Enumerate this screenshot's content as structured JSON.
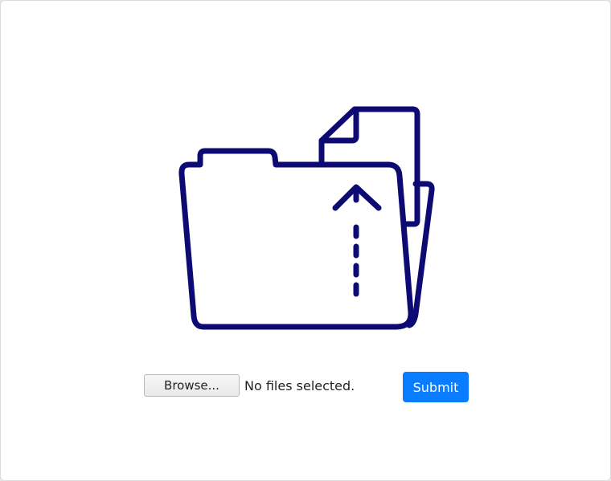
{
  "illustration": {
    "icon": "folder-upload-icon",
    "stroke_color": "#0d0b73"
  },
  "upload": {
    "browse_label": "Browse...",
    "file_status": "No files selected.",
    "submit_label": "Submit",
    "submit_color": "#0a7cff"
  }
}
